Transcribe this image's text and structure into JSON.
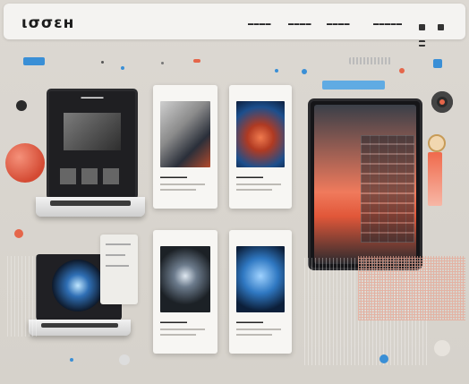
{
  "header": {
    "logo": "ισσεн",
    "nav": [
      "▬▬▬▬",
      "▬▬▬▬",
      "▬▬▬▬",
      "▬▬▬▬▬"
    ]
  },
  "cards": [
    {
      "title": "▬▬▬▬▬▬",
      "subtitle": "▬▬▬▬▬▬"
    },
    {
      "title": "▬▬▬▬▬▬",
      "subtitle": "▬▬▬▬▬▬"
    },
    {
      "title": "▬▬▬▬▬▬",
      "subtitle": "▬▬▬▬▬▬"
    },
    {
      "title": "▬▬▬▬▬▬",
      "subtitle": "▬▬▬▬▬▬"
    }
  ],
  "laptop_screen_label": "▬▬▬▬▬",
  "icons": {
    "nav_square": "square-icon",
    "nav_menu": "menu-icon",
    "speaker": "speaker-icon",
    "orb": "orb-icon"
  },
  "colors": {
    "accent_orange": "#e5664a",
    "accent_blue": "#3a8fd6",
    "background": "#d9d5cf",
    "header_bg": "#f4f3f1"
  }
}
